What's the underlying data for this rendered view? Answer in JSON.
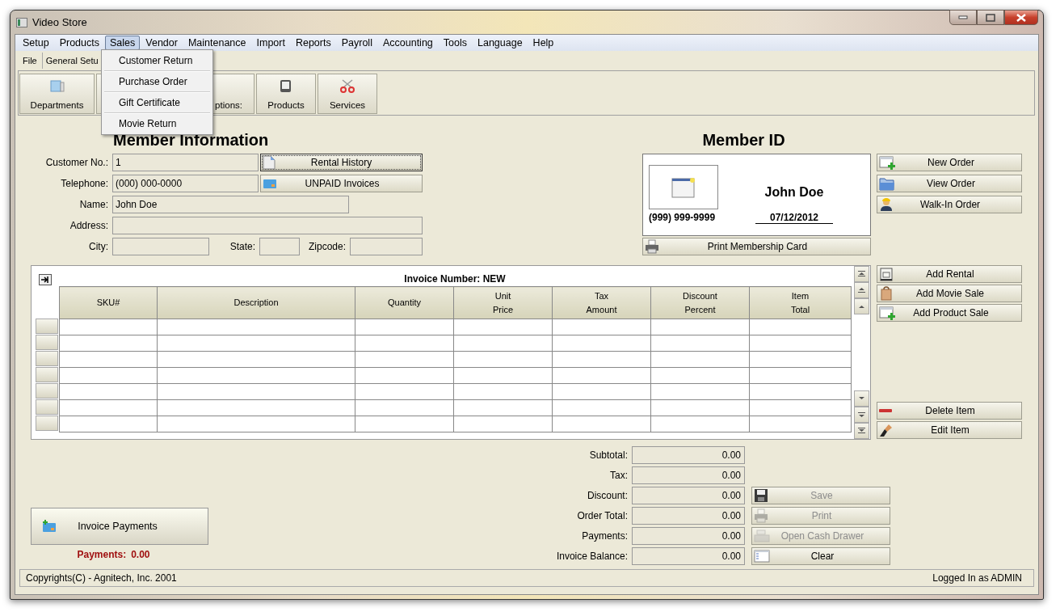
{
  "window": {
    "title": "Video Store"
  },
  "menu": [
    {
      "label": "Setup",
      "selected": false
    },
    {
      "label": "Products",
      "selected": false
    },
    {
      "label": "Sales",
      "selected": true
    },
    {
      "label": "Vendor",
      "selected": false
    },
    {
      "label": "Maintenance",
      "selected": false
    },
    {
      "label": "Import",
      "selected": false
    },
    {
      "label": "Reports",
      "selected": false
    },
    {
      "label": "Payroll",
      "selected": false
    },
    {
      "label": "Accounting",
      "selected": false
    },
    {
      "label": "Tools",
      "selected": false
    },
    {
      "label": "Language",
      "selected": false
    },
    {
      "label": "Help",
      "selected": false
    }
  ],
  "open_menu": {
    "items": [
      "Customer Return",
      "Purchase Order",
      "Gift Certificate",
      "Movie Return"
    ]
  },
  "tabs": [
    {
      "label": "File"
    },
    {
      "label": "General Setu"
    }
  ],
  "toolbar": [
    {
      "kind": "button",
      "label": "Departments"
    },
    {
      "kind": "covered"
    },
    {
      "kind": "button",
      "label": "ptions:"
    },
    {
      "kind": "button",
      "label": "Products"
    },
    {
      "kind": "button",
      "label": "Services"
    }
  ],
  "member_info": {
    "title": "Member Information",
    "customer_no": {
      "label": "Customer No.:",
      "value": "1"
    },
    "telephone": {
      "label": "Telephone:",
      "value": "(000) 000-0000"
    },
    "name": {
      "label": "Name:",
      "value": "John Doe"
    },
    "address": {
      "label": "Address:"
    },
    "city": {
      "label": "City:"
    },
    "state": {
      "label": "State:"
    },
    "zipcode": {
      "label": "Zipcode:"
    },
    "rental_history_button": "Rental History",
    "unpaid_invoices_button": "UNPAID Invoices"
  },
  "member_id": {
    "title": "Member ID",
    "name": "John Doe",
    "phone": "(999) 999-9999",
    "date": "07/12/2012",
    "print_button": "Print Membership Card"
  },
  "order_buttons": [
    {
      "label": "New Order"
    },
    {
      "label": "View Order"
    },
    {
      "label": "Walk-In Order"
    }
  ],
  "invoice": {
    "title": "Invoice Number: NEW",
    "columns": [
      {
        "lines": [
          "SKU#"
        ]
      },
      {
        "lines": [
          "Description"
        ]
      },
      {
        "lines": [
          "Quantity"
        ]
      },
      {
        "lines": [
          "Unit",
          "Price"
        ]
      },
      {
        "lines": [
          "Tax",
          "Amount"
        ]
      },
      {
        "lines": [
          "Discount",
          "Percent"
        ]
      },
      {
        "lines": [
          "Item",
          "Total"
        ]
      }
    ]
  },
  "item_buttons": [
    {
      "label": "Add Rental"
    },
    {
      "label": "Add Movie Sale"
    },
    {
      "label": "Add Product Sale"
    }
  ],
  "edit_buttons": [
    {
      "label": "Delete Item"
    },
    {
      "label": "Edit Item"
    }
  ],
  "totals": [
    {
      "label": "Subtotal:",
      "value": "0.00"
    },
    {
      "label": "Tax:",
      "value": "0.00"
    },
    {
      "label": "Discount:",
      "value": "0.00"
    },
    {
      "label": "Order Total:",
      "value": "0.00"
    },
    {
      "label": "Payments:",
      "value": "0.00"
    },
    {
      "label": "Invoice Balance:",
      "value": "0.00"
    }
  ],
  "action_buttons": [
    {
      "label": "Save",
      "disabled": true
    },
    {
      "label": "Print",
      "disabled": true
    },
    {
      "label": "Open Cash Drawer",
      "disabled": true
    },
    {
      "label": "Clear",
      "disabled": false
    }
  ],
  "payments": {
    "button": "Invoice Payments",
    "label": "Payments:",
    "value": "0.00"
  },
  "status_bar": {
    "left": "Copyrights(C) - Agnitech, Inc. 2001",
    "right": "Logged In as ADMIN"
  }
}
